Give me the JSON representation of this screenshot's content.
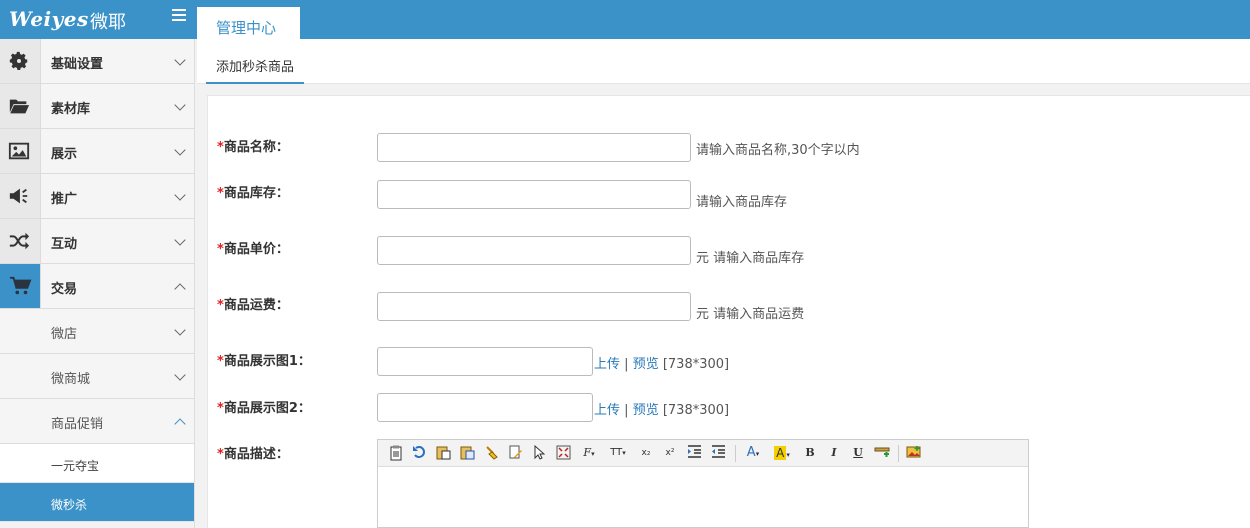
{
  "header": {
    "logo_text": "Weiyes",
    "logo_cn": "微耶",
    "active_tab": "管理中心"
  },
  "sidebar": {
    "items": [
      {
        "label": "基础设置",
        "icon": "gear-icon"
      },
      {
        "label": "素材库",
        "icon": "folder-open-icon"
      },
      {
        "label": "展示",
        "icon": "image-icon"
      },
      {
        "label": "推广",
        "icon": "megaphone-icon"
      },
      {
        "label": "互动",
        "icon": "shuffle-icon"
      },
      {
        "label": "交易",
        "icon": "cart-icon"
      }
    ],
    "trade_sub": [
      {
        "label": "微店"
      },
      {
        "label": "微商城"
      },
      {
        "label": "商品促销"
      }
    ],
    "promo_sub": [
      {
        "label": "一元夺宝"
      },
      {
        "label": "微秒杀"
      }
    ]
  },
  "subtab": "添加秒杀商品",
  "form": {
    "required_mark": "*",
    "name": {
      "label": "商品名称：",
      "hint": "请输入商品名称,30个字以内",
      "value": ""
    },
    "stock": {
      "label": "商品库存：",
      "hint": "请输入商品库存",
      "value": ""
    },
    "price": {
      "label": "商品单价：",
      "unit": "元",
      "hint": "请输入商品库存",
      "value": ""
    },
    "shipping": {
      "label": "商品运费：",
      "unit": "元",
      "hint": "请输入商品运费",
      "value": ""
    },
    "image1": {
      "label": "商品展示图1：",
      "upload": "上传",
      "sep": "|",
      "preview": "预览",
      "size": "[738*300]",
      "value": ""
    },
    "image2": {
      "label": "商品展示图2：",
      "upload": "上传",
      "sep": "|",
      "preview": "预览",
      "size": "[738*300]",
      "value": ""
    },
    "description": {
      "label": "商品描述："
    }
  },
  "editor_tools": {
    "font_color": "A",
    "highlight": "A",
    "bold": "B",
    "italic": "I",
    "underline": "U",
    "font_family": "F",
    "font_size": "TT",
    "subscript": "x₂",
    "superscript": "x²"
  },
  "colors": {
    "brand": "#3a92c8",
    "required": "#e02020",
    "link": "#2a7ab8"
  }
}
